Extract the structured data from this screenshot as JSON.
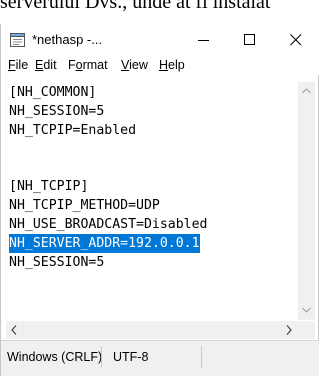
{
  "background": {
    "text": "serverului Dvs., unde at fi instalat"
  },
  "window": {
    "title": "*nethasp -...",
    "minimize": "—",
    "maximize": "☐",
    "close": "✕"
  },
  "menu": {
    "file": {
      "mnemonic": "F",
      "rest": "ile"
    },
    "edit": {
      "mnemonic": "E",
      "rest": "dit"
    },
    "format": {
      "pre": "F",
      "mnemonic": "o",
      "rest": "rmat"
    },
    "view": {
      "mnemonic": "V",
      "rest": "iew"
    },
    "help": {
      "mnemonic": "H",
      "rest": "elp"
    }
  },
  "editor": {
    "lines": [
      "[NH_COMMON]",
      "NH_SESSION=5",
      "NH_TCPIP=Enabled",
      "",
      "[NH_TCPIP]",
      "NH_TCPIP_METHOD=UDP",
      "NH_USE_BROADCAST=Disabled",
      "NH_SERVER_ADDR=192.0.0.1",
      "NH_SESSION=5"
    ],
    "selected_line_index": 7
  },
  "scroll": {
    "up": "^",
    "down": "v",
    "left": "<",
    "right": ">"
  },
  "status": {
    "line_ending": "Windows (CRLF)",
    "encoding": "UTF-8"
  },
  "colors": {
    "selection": "#0078d7",
    "statusbar": "#f0f0f0"
  }
}
